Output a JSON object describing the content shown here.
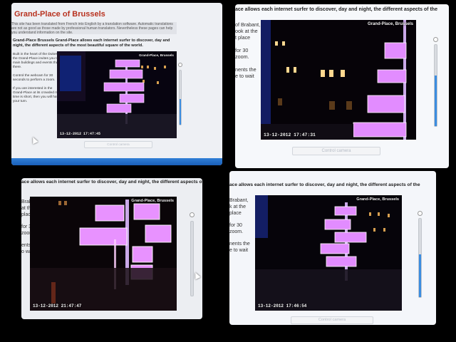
{
  "page": {
    "title": "Grand-Place of Brussels",
    "notice": "This site has been translated from French into English by a translation software. Automatic translations are not as good as those made by professional human translators. Nevertheless these pages can help you understand information on the site."
  },
  "headings": {
    "full": "Grand-Place Brussels Grand-Place allows each internet surfer to discover, day and night, the different aspects of the most beautiful square of the world.",
    "cut": "ace allows each internet surfer to discover, day and night, the different aspects of the"
  },
  "sidebar": {
    "p1": [
      "Built in the heart of the Dukes of Brabant,",
      "the Grand-Place invites you to take a look at the",
      "main buildings and events that take place",
      "there.",
      "",
      "Control the webcam for 30",
      "seconds to perform a zoom.",
      "",
      "If you are interested in the",
      "Grand-Place at its crowded moments the",
      "time is short, then you will have to wait",
      "your turn."
    ],
    "p2": [
      "of Brabant,",
      "ook at the",
      "t place",
      "",
      "for 30",
      "zoom.",
      "",
      "nents the",
      "e to wait"
    ],
    "p3": [
      "Brabant,",
      "at the",
      "place",
      "",
      "for 30",
      "zoom.",
      "",
      "ents the",
      "o wait"
    ],
    "p4": [
      "Brabant,",
      "k at the",
      "place",
      "",
      "for 30",
      "zoom.",
      "",
      "nents the",
      "e to wait"
    ]
  },
  "webcam": {
    "location": "Grand-Place, Brussels",
    "location_partial": "Grand-Place, Brussels",
    "timestamps": [
      "13-12-2012 17:47:45",
      "13-12-2012 17:47:31",
      "13-12-2012 21:47:47",
      "13-12-2012 17:46:54"
    ]
  },
  "zoom_levels": [
    0.48,
    0.62,
    0.0,
    0.55
  ],
  "control_button": "Control camera",
  "colors": {
    "title": "#b8321f",
    "zoom_fill": "#3b8de0",
    "tree_glow": "#e28cff",
    "taskbar": "#1f6cc4"
  }
}
